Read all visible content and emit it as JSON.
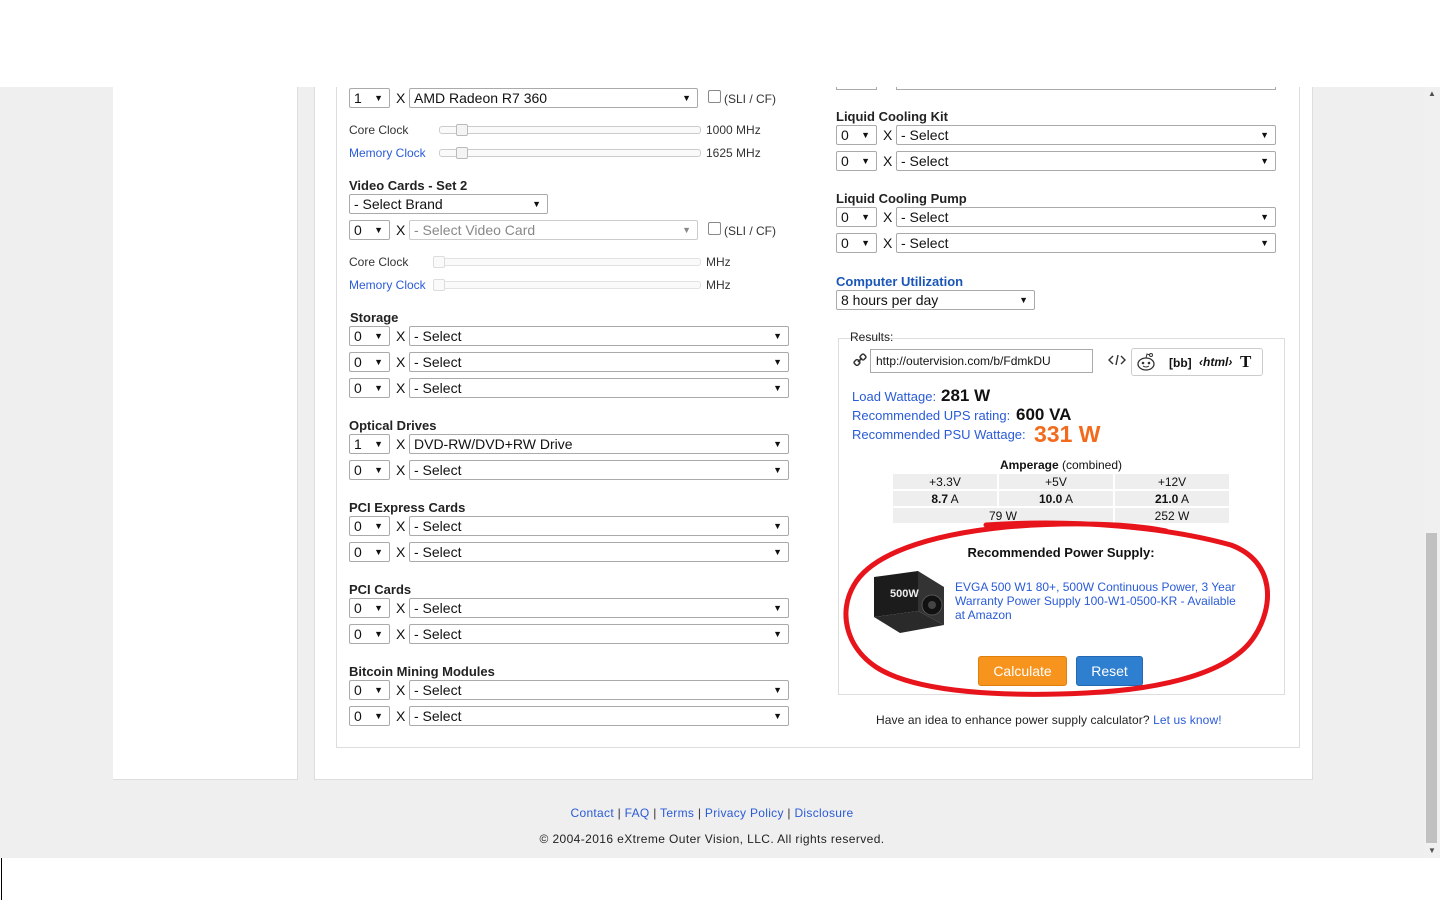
{
  "left_column": {
    "video_set1": {
      "qty": "1",
      "card": "AMD Radeon R7 360",
      "sli_label": "(SLI / CF)",
      "core_clock_label": "Core Clock",
      "core_clock_value": "1000 MHz",
      "memory_clock_label": "Memory Clock",
      "memory_clock_value": "1625 MHz"
    },
    "video_set2": {
      "title": "Video Cards - Set 2",
      "brand": "- Select Brand",
      "qty": "0",
      "card": "- Select Video Card",
      "sli_label": "(SLI / CF)",
      "core_clock_label": "Core Clock",
      "core_clock_unit": "MHz",
      "memory_clock_label": "Memory Clock",
      "memory_clock_unit": "MHz"
    },
    "storage": {
      "title": "Storage",
      "rows": [
        {
          "qty": "0",
          "item": "- Select"
        },
        {
          "qty": "0",
          "item": "- Select"
        },
        {
          "qty": "0",
          "item": "- Select"
        }
      ]
    },
    "optical": {
      "title": "Optical Drives",
      "rows": [
        {
          "qty": "1",
          "item": "DVD-RW/DVD+RW Drive"
        },
        {
          "qty": "0",
          "item": "- Select"
        }
      ]
    },
    "pcie": {
      "title": "PCI Express Cards",
      "rows": [
        {
          "qty": "0",
          "item": "- Select"
        },
        {
          "qty": "0",
          "item": "- Select"
        }
      ]
    },
    "pci": {
      "title": "PCI Cards",
      "rows": [
        {
          "qty": "0",
          "item": "- Select"
        },
        {
          "qty": "0",
          "item": "- Select"
        }
      ]
    },
    "bitcoin": {
      "title": "Bitcoin Mining Modules",
      "rows": [
        {
          "qty": "0",
          "item": "- Select"
        },
        {
          "qty": "0",
          "item": "- Select"
        }
      ]
    }
  },
  "right_column": {
    "liquid_kit": {
      "title": "Liquid Cooling Kit",
      "rows": [
        {
          "qty": "0",
          "item": "- Select"
        },
        {
          "qty": "0",
          "item": "- Select"
        }
      ]
    },
    "liquid_pump": {
      "title": "Liquid Cooling Pump",
      "rows": [
        {
          "qty": "0",
          "item": "- Select"
        },
        {
          "qty": "0",
          "item": "- Select"
        }
      ]
    },
    "utilization": {
      "title": "Computer Utilization",
      "value": "8 hours per day"
    },
    "results": {
      "label": "Results:",
      "url": "http://outervision.com/b/FdmkDU",
      "share_bb": "[bb]",
      "share_html": "‹html›",
      "share_t": "T",
      "load_label": "Load Wattage:",
      "load_value": "281 W",
      "ups_label": "Recommended UPS rating:",
      "ups_value": "600 VA",
      "psu_label": "Recommended PSU Wattage:",
      "psu_value": "331 W",
      "amperage_title": "Amperage",
      "amperage_sub": "(combined)",
      "rails": [
        "+3.3V",
        "+5V",
        "+12V"
      ],
      "amps": [
        "8.7",
        "10.0",
        "21.0"
      ],
      "amp_unit": "A",
      "watts": [
        "79 W",
        "252 W"
      ],
      "rec_title": "Recommended Power Supply:",
      "rec_product": "EVGA 500 W1 80+, 500W Continuous Power, 3 Year Warranty Power Supply 100-W1-0500-KR - Available at Amazon",
      "psu_box_text": "500W",
      "calculate": "Calculate",
      "reset": "Reset"
    },
    "idea_text": "Have an idea to enhance power supply calculator?",
    "idea_link": "Let us know!"
  },
  "footer": {
    "links": [
      "Contact",
      "FAQ",
      "Terms",
      "Privacy Policy",
      "Disclosure"
    ],
    "copyright": "© 2004-2016 eXtreme Outer Vision, LLC. All rights reserved."
  },
  "colors": {
    "accent_blue": "#2a5bd7",
    "psu_orange": "#f26b1d",
    "calc_orange": "#f7941d",
    "reset_blue": "#2f7fd0",
    "highlight_red": "#e8141b"
  }
}
